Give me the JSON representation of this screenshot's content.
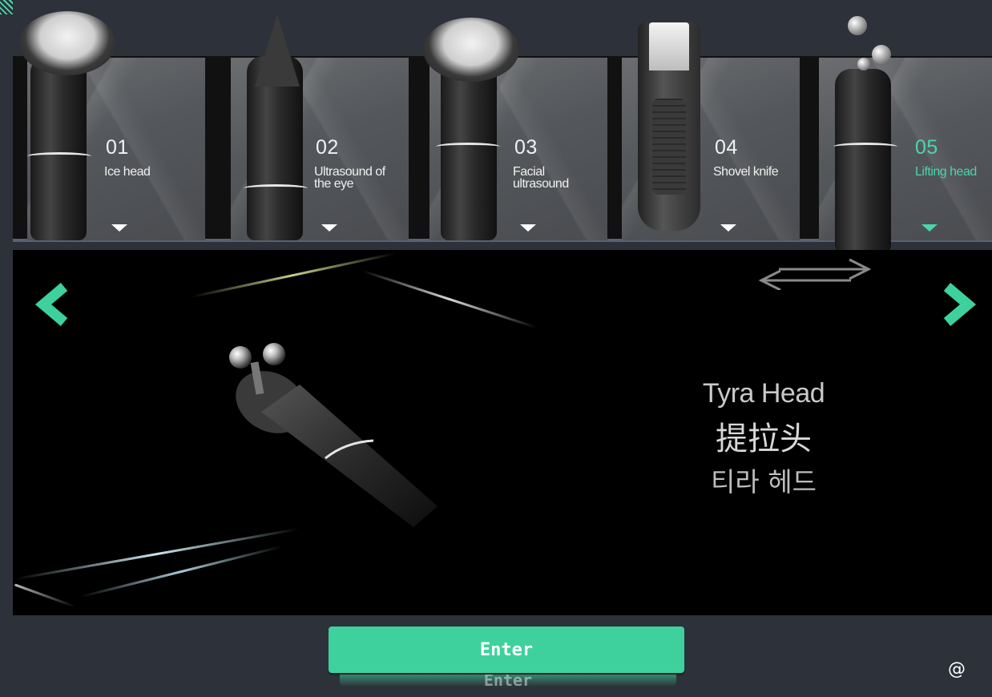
{
  "heads": [
    {
      "number": "01",
      "name": "Ice head",
      "icon": "ice-head-icon"
    },
    {
      "number": "02",
      "name": "Ultrasound of the eye",
      "icon": "eye-ultrasound-icon"
    },
    {
      "number": "03",
      "name": "Facial ultrasound",
      "icon": "facial-ultrasound-icon"
    },
    {
      "number": "04",
      "name": "Shovel knife",
      "icon": "shovel-knife-icon"
    },
    {
      "number": "05",
      "name": "Lifting head",
      "icon": "lifting-head-icon"
    }
  ],
  "selected_index": 4,
  "product": {
    "name_en": "Tyra Head",
    "name_zh": "提拉头",
    "name_ko": "티라 헤드"
  },
  "footer": {
    "enter_label": "Enter",
    "at_symbol": "@"
  },
  "colors": {
    "accent": "#3ed19e",
    "background": "#2d3139",
    "stage": "#000000"
  }
}
